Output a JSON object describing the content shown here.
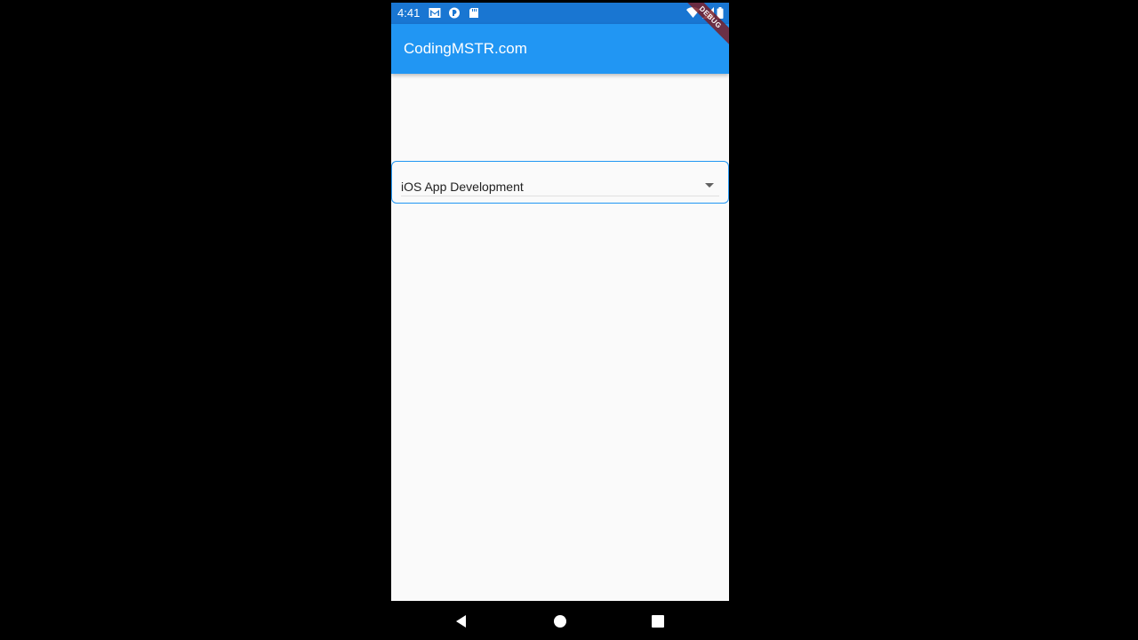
{
  "status_bar": {
    "time": "4:41",
    "notification_icons": [
      "gmail-icon",
      "pocket-casts-icon",
      "sd-card-icon"
    ],
    "system_icons": [
      "wifi-icon",
      "signal-icon",
      "battery-icon"
    ]
  },
  "app_bar": {
    "title": "CodingMSTR.com",
    "debug_banner": "DEBUG"
  },
  "dropdown": {
    "selected_value": "iOS App Development",
    "icon": "arrow-drop-down-icon"
  },
  "nav_bar": {
    "buttons": [
      "back-icon",
      "home-icon",
      "recents-icon"
    ]
  },
  "colors": {
    "status_bar": "#1976d2",
    "app_bar": "#2196f3",
    "background": "#fafafa",
    "dropdown_border": "#2196f3"
  }
}
